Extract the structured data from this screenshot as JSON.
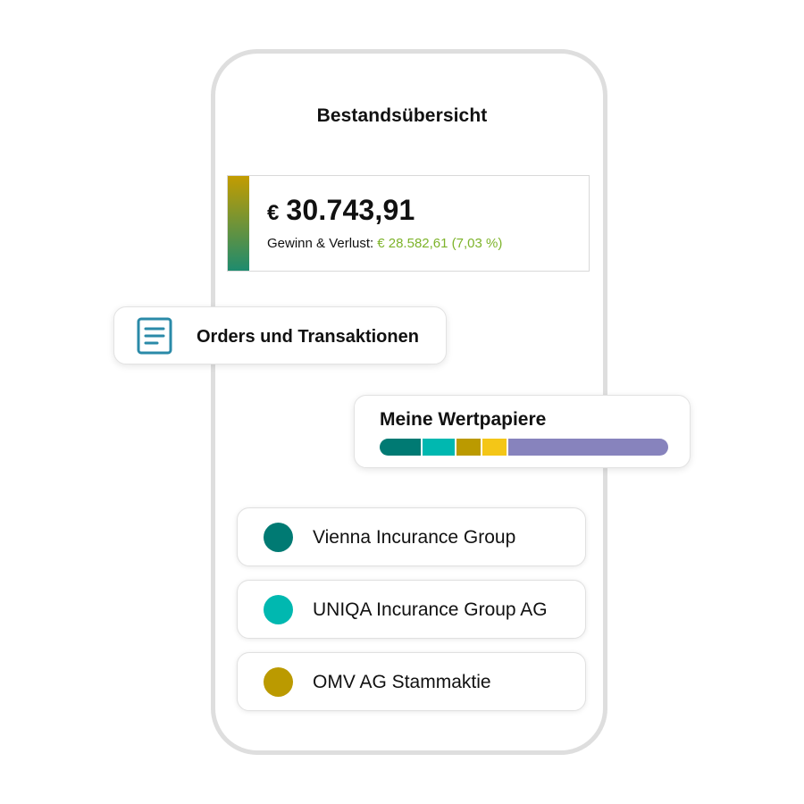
{
  "header": {
    "title": "Bestandsübersicht"
  },
  "balance": {
    "currency": "€",
    "amount": "30.743,91",
    "pl_label": "Gewinn & Verlust:",
    "pl_value": "€ 28.582,61 (7,03 %)",
    "pl_color": "#7db32a",
    "bar_gradient": [
      "#c39c00",
      "#1e8b6e"
    ]
  },
  "orders": {
    "label": "Orders und Transaktionen",
    "icon": "document-list-icon",
    "icon_color": "#2a8aa8"
  },
  "securities": {
    "title": "Meine Wertpapiere",
    "allocation": [
      {
        "share": 0.15,
        "color": "#007a73"
      },
      {
        "share": 0.115,
        "color": "#00b8b0"
      },
      {
        "share": 0.09,
        "color": "#bb9a00"
      },
      {
        "share": 0.09,
        "color": "#f4c617"
      },
      {
        "share": 0.555,
        "color": "#8783bd"
      }
    ]
  },
  "holdings": [
    {
      "name": "Vienna Incurance Group",
      "color": "#007a73"
    },
    {
      "name": "UNIQA Incurance Group AG",
      "color": "#00b8b0"
    },
    {
      "name": "OMV AG Stammaktie",
      "color": "#bb9a00"
    }
  ]
}
